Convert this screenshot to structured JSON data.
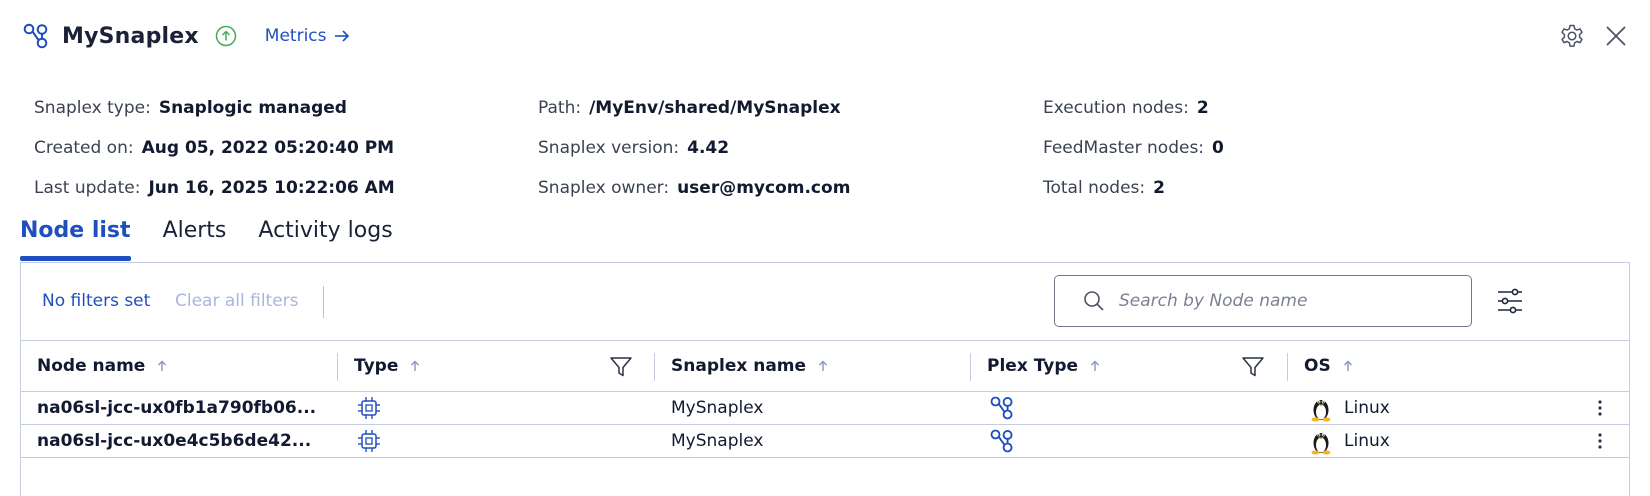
{
  "header": {
    "title": "MySnaplex",
    "metrics_label": "Metrics"
  },
  "info": {
    "col1": [
      {
        "label": "Snaplex type:",
        "value": "Snaplogic managed"
      },
      {
        "label": "Created on:",
        "value": "Aug 05, 2022 05:20:40 PM"
      },
      {
        "label": "Last update:",
        "value": "Jun 16, 2025 10:22:06 AM"
      }
    ],
    "col2": [
      {
        "label": "Path:",
        "value": "/MyEnv/shared/MySnaplex"
      },
      {
        "label": "Snaplex version:",
        "value": "4.42"
      },
      {
        "label": "Snaplex owner:",
        "value": "user@mycom.com"
      }
    ],
    "col3": [
      {
        "label": "Execution nodes:",
        "value": "2"
      },
      {
        "label": "FeedMaster nodes:",
        "value": "0"
      },
      {
        "label": "Total nodes:",
        "value": "2"
      }
    ]
  },
  "tabs": [
    {
      "label": "Node list",
      "active": true
    },
    {
      "label": "Alerts",
      "active": false
    },
    {
      "label": "Activity logs",
      "active": false
    }
  ],
  "filters": {
    "status": "No filters set",
    "clear_label": "Clear all filters"
  },
  "search": {
    "placeholder": "Search by Node name"
  },
  "table": {
    "columns": [
      "Node name",
      "Type",
      "Snaplex name",
      "Plex Type",
      "OS"
    ],
    "rows": [
      {
        "node_name": "na06sl-jcc-ux0fb1a790fb06...",
        "type_icon": "processor-chip-icon",
        "snaplex_name": "MySnaplex",
        "plex_type_icon": "snaplex-icon",
        "os_icon": "linux-penguin-icon",
        "os": "Linux"
      },
      {
        "node_name": "na06sl-jcc-ux0e4c5b6de42...",
        "type_icon": "processor-chip-icon",
        "snaplex_name": "MySnaplex",
        "plex_type_icon": "snaplex-icon",
        "os_icon": "linux-penguin-icon",
        "os": "Linux"
      }
    ]
  },
  "colors": {
    "accent": "#1f4fbf",
    "status_up": "#3fae5a",
    "border": "#c3cce0"
  }
}
